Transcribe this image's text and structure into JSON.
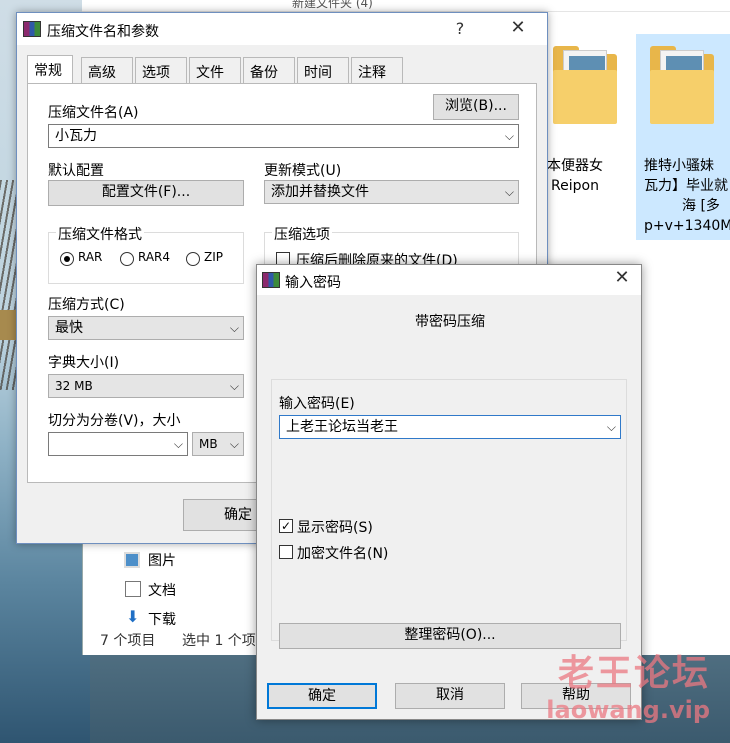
{
  "explorer": {
    "breadcrumb": "新建文件夹 (4)",
    "folders": [
      {
        "label_lines": [
          "本便器女",
          "Reipon"
        ]
      },
      {
        "label_lines": [
          "推特小骚妹",
          "瓦力】毕业就",
          "海 [多",
          "p+v+1340M"
        ]
      }
    ],
    "nav": [
      "图片",
      "文档",
      "下载"
    ],
    "status_items": "7 个项目",
    "status_selected": "选中 1 个项"
  },
  "main_dialog": {
    "title": "压缩文件名和参数",
    "help_glyph": "?",
    "close_glyph": "✕",
    "tabs": [
      "常规",
      "高级",
      "选项",
      "文件",
      "备份",
      "时间",
      "注释"
    ],
    "archive_name_label": "压缩文件名(A)",
    "browse_label": "浏览(B)...",
    "archive_name_value": "小瓦力",
    "default_profile_label": "默认配置",
    "profile_button": "配置文件(F)...",
    "update_mode_label": "更新模式(U)",
    "update_mode_value": "添加并替换文件",
    "format_group": "压缩文件格式",
    "formats": [
      "RAR",
      "RAR4",
      "ZIP"
    ],
    "selected_format": "RAR",
    "options_group": "压缩选项",
    "option_delete": "压缩后删除原来的文件(D)",
    "method_label": "压缩方式(C)",
    "method_value": "最快",
    "dict_label": "字典大小(I)",
    "dict_value": "32 MB",
    "split_label": "切分为分卷(V)，大小",
    "split_value": "",
    "split_unit": "MB",
    "ok_label": "确定"
  },
  "password_dialog": {
    "title": "输入密码",
    "close_glyph": "✕",
    "heading": "带密码压缩",
    "enter_label": "输入密码(E)",
    "password_value": "上老王论坛当老王",
    "show_password": {
      "label": "显示密码(S)",
      "checked": true
    },
    "encrypt_names": {
      "label": "加密文件名(N)",
      "checked": false
    },
    "organize_label": "整理密码(O)...",
    "ok_label": "确定",
    "cancel_label": "取消",
    "help_label": "帮助"
  },
  "watermark": {
    "cn": "老王论坛",
    "en": "laowang.vip"
  }
}
